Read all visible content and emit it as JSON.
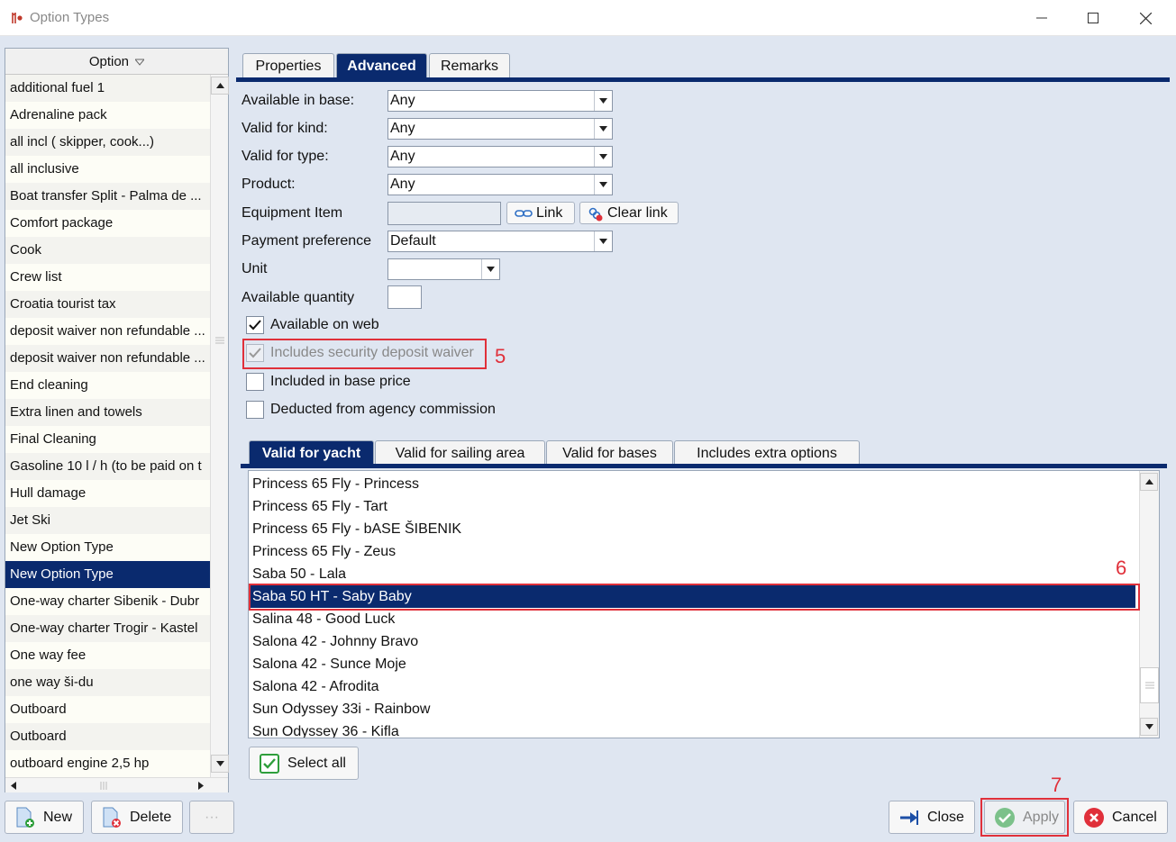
{
  "window": {
    "title": "Option Types",
    "controls": [
      "minimize",
      "maximize",
      "close"
    ]
  },
  "list": {
    "header": "Option",
    "items": [
      {
        "label": "additional fuel 1"
      },
      {
        "label": "Adrenaline pack"
      },
      {
        "label": "all incl ( skipper, cook...)"
      },
      {
        "label": "all inclusive"
      },
      {
        "label": "Boat transfer Split - Palma de ..."
      },
      {
        "label": "Comfort package"
      },
      {
        "label": "Cook"
      },
      {
        "label": "Crew list"
      },
      {
        "label": "Croatia tourist tax"
      },
      {
        "label": "deposit waiver non refundable ..."
      },
      {
        "label": "deposit waiver non refundable ..."
      },
      {
        "label": "End cleaning"
      },
      {
        "label": "Extra linen and towels"
      },
      {
        "label": "Final Cleaning"
      },
      {
        "label": "Gasoline 10 l / h (to be paid on t"
      },
      {
        "label": "Hull damage"
      },
      {
        "label": "Jet Ski"
      },
      {
        "label": "New Option Type"
      },
      {
        "label": "New Option Type",
        "selected": true
      },
      {
        "label": "One-way charter Sibenik - Dubr"
      },
      {
        "label": "One-way charter Trogir - Kastel"
      },
      {
        "label": "One way fee"
      },
      {
        "label": "one way ši-du"
      },
      {
        "label": "Outboard"
      },
      {
        "label": "Outboard"
      },
      {
        "label": "outboard engine 2,5 hp"
      }
    ]
  },
  "left_buttons": {
    "new_label": "New",
    "delete_label": "Delete",
    "more_label": "···"
  },
  "tabs": {
    "properties": "Properties",
    "advanced": "Advanced",
    "remarks": "Remarks",
    "active": "Advanced"
  },
  "form": {
    "available_in_base": {
      "label": "Available in base:",
      "value": "Any"
    },
    "valid_for_kind": {
      "label": "Valid for kind:",
      "value": "Any"
    },
    "valid_for_type": {
      "label": "Valid for type:",
      "value": "Any"
    },
    "product": {
      "label": "Product:",
      "value": "Any"
    },
    "equipment_item": {
      "label": "Equipment Item",
      "value": "",
      "link_label": "Link",
      "clear_link_label": "Clear link"
    },
    "payment_preference": {
      "label": "Payment preference",
      "value": "Default"
    },
    "unit": {
      "label": "Unit",
      "value": ""
    },
    "available_quantity": {
      "label": "Available quantity",
      "value": ""
    },
    "checkboxes": {
      "available_on_web": {
        "label": "Available on web",
        "checked": true,
        "enabled": true
      },
      "includes_security_deposit_waiver": {
        "label": "Includes security deposit waiver",
        "checked": true,
        "enabled": false
      },
      "included_in_base_price": {
        "label": "Included in base price",
        "checked": false,
        "enabled": true
      },
      "deducted_from_agency_commission": {
        "label": "Deducted from agency commission",
        "checked": false,
        "enabled": true
      }
    }
  },
  "annotations": {
    "n5": "5",
    "n6": "6",
    "n7": "7"
  },
  "subtabs": {
    "valid_for_yacht": "Valid for yacht",
    "valid_for_sailing_area": "Valid for sailing area",
    "valid_for_bases": "Valid for bases",
    "includes_extra_options": "Includes extra options",
    "active": "Valid for yacht"
  },
  "yachts": [
    {
      "label": "Princess 65 Fly - Princess"
    },
    {
      "label": "Princess 65 Fly - Tart"
    },
    {
      "label": "Princess 65 Fly - bASE ŠIBENIK"
    },
    {
      "label": "Princess 65 Fly - Zeus"
    },
    {
      "label": "Saba 50 - Lala"
    },
    {
      "label": "Saba 50 HT - Saby Baby",
      "selected": true
    },
    {
      "label": "Salina 48 - Good Luck"
    },
    {
      "label": "Salona 42 - Johnny Bravo"
    },
    {
      "label": "Salona 42 - Sunce Moje"
    },
    {
      "label": "Salona 42 - Afrodita"
    },
    {
      "label": "Sun Odyssey 33i - Rainbow"
    },
    {
      "label": "Sun Odyssey 36 - Kifla"
    }
  ],
  "select_all_label": "Select all",
  "bottom_buttons": {
    "close_label": "Close",
    "apply_label": "Apply",
    "cancel_label": "Cancel"
  },
  "colors": {
    "accent": "#0a2a6e",
    "annotation_red": "#e0303a",
    "background": "#dfe6f1"
  }
}
